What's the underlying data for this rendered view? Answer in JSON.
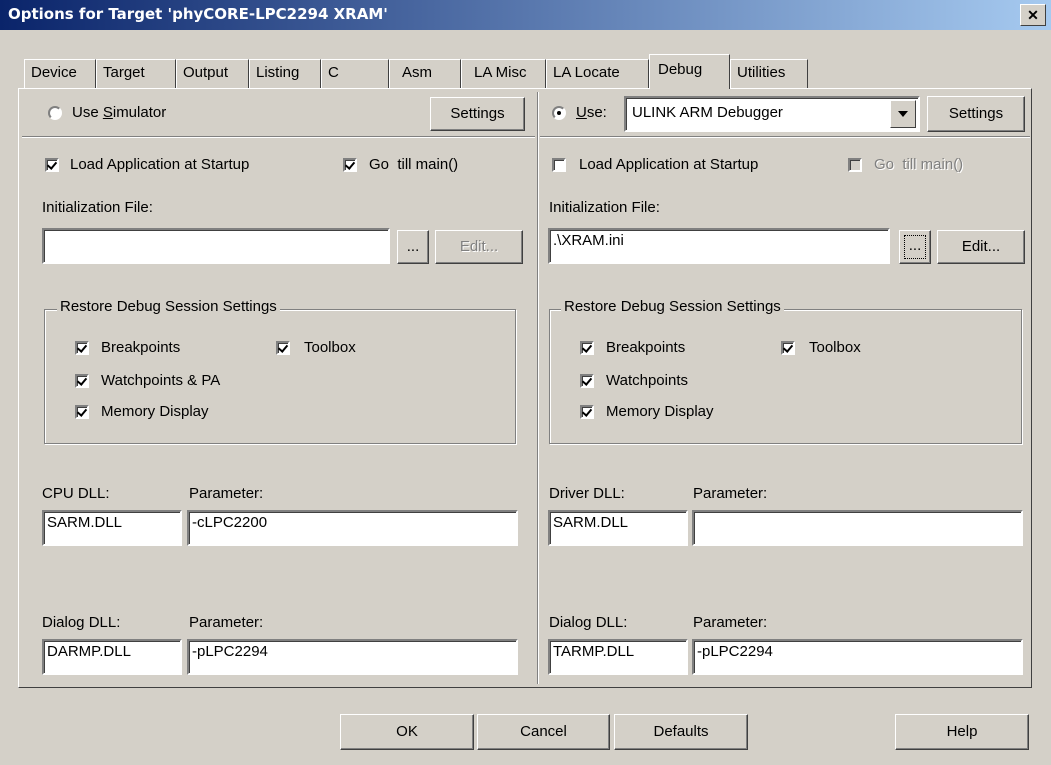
{
  "window": {
    "title": "Options for Target 'phyCORE-LPC2294 XRAM'",
    "close": "✕"
  },
  "tabs": [
    "Device",
    "Target",
    "Output",
    "Listing",
    "C",
    "Asm",
    "LA Misc",
    "LA Locate",
    "Debug",
    "Utilities"
  ],
  "active_tab": "Debug",
  "simulator": {
    "use_label_pre": "Use ",
    "use_label_acc": "S",
    "use_label_post": "imulator",
    "selected": false,
    "settings_label": "Settings",
    "load_app_label": "Load Application at Startup",
    "load_app_checked": true,
    "go_main_label": "Go  till main()",
    "go_main_checked": true,
    "init_file_label": "Initialization File:",
    "init_file_value": "",
    "browse_label": "...",
    "edit_label": "Edit...",
    "restore_title": "Restore Debug Session Settings",
    "breakpoints_label": "Breakpoints",
    "toolbox_label": "Toolbox",
    "watchpoints_label": "Watchpoints & PA",
    "memory_label": "Memory Display",
    "cpu_dll_label": "CPU DLL:",
    "cpu_param_label": "Parameter:",
    "cpu_dll_value": "SARM.DLL",
    "cpu_param_value": "-cLPC2200",
    "dialog_dll_label": "Dialog DLL:",
    "dialog_param_label": "Parameter:",
    "dialog_dll_value": "DARMP.DLL",
    "dialog_param_value": "-pLPC2294"
  },
  "target": {
    "use_label_acc": "U",
    "use_label_post": "se:",
    "selected": true,
    "debugger_value": "ULINK ARM Debugger",
    "settings_label": "Settings",
    "load_app_label": "Load Application at Startup",
    "load_app_checked": false,
    "go_main_label": "Go  till main()",
    "go_main_checked": false,
    "init_file_label": "Initialization File:",
    "init_file_value": ".\\XRAM.ini",
    "browse_label": "...",
    "edit_label": "Edit...",
    "restore_title": "Restore Debug Session Settings",
    "breakpoints_label": "Breakpoints",
    "toolbox_label": "Toolbox",
    "watchpoints_label": "Watchpoints",
    "memory_label": "Memory Display",
    "driver_dll_label": "Driver DLL:",
    "driver_param_label": "Parameter:",
    "driver_dll_value": "SARM.DLL",
    "driver_param_value": "",
    "dialog_dll_label": "Dialog DLL:",
    "dialog_param_label": "Parameter:",
    "dialog_dll_value": "TARMP.DLL",
    "dialog_param_value": "-pLPC2294"
  },
  "footer": {
    "ok": "OK",
    "cancel": "Cancel",
    "defaults": "Defaults",
    "help": "Help"
  }
}
